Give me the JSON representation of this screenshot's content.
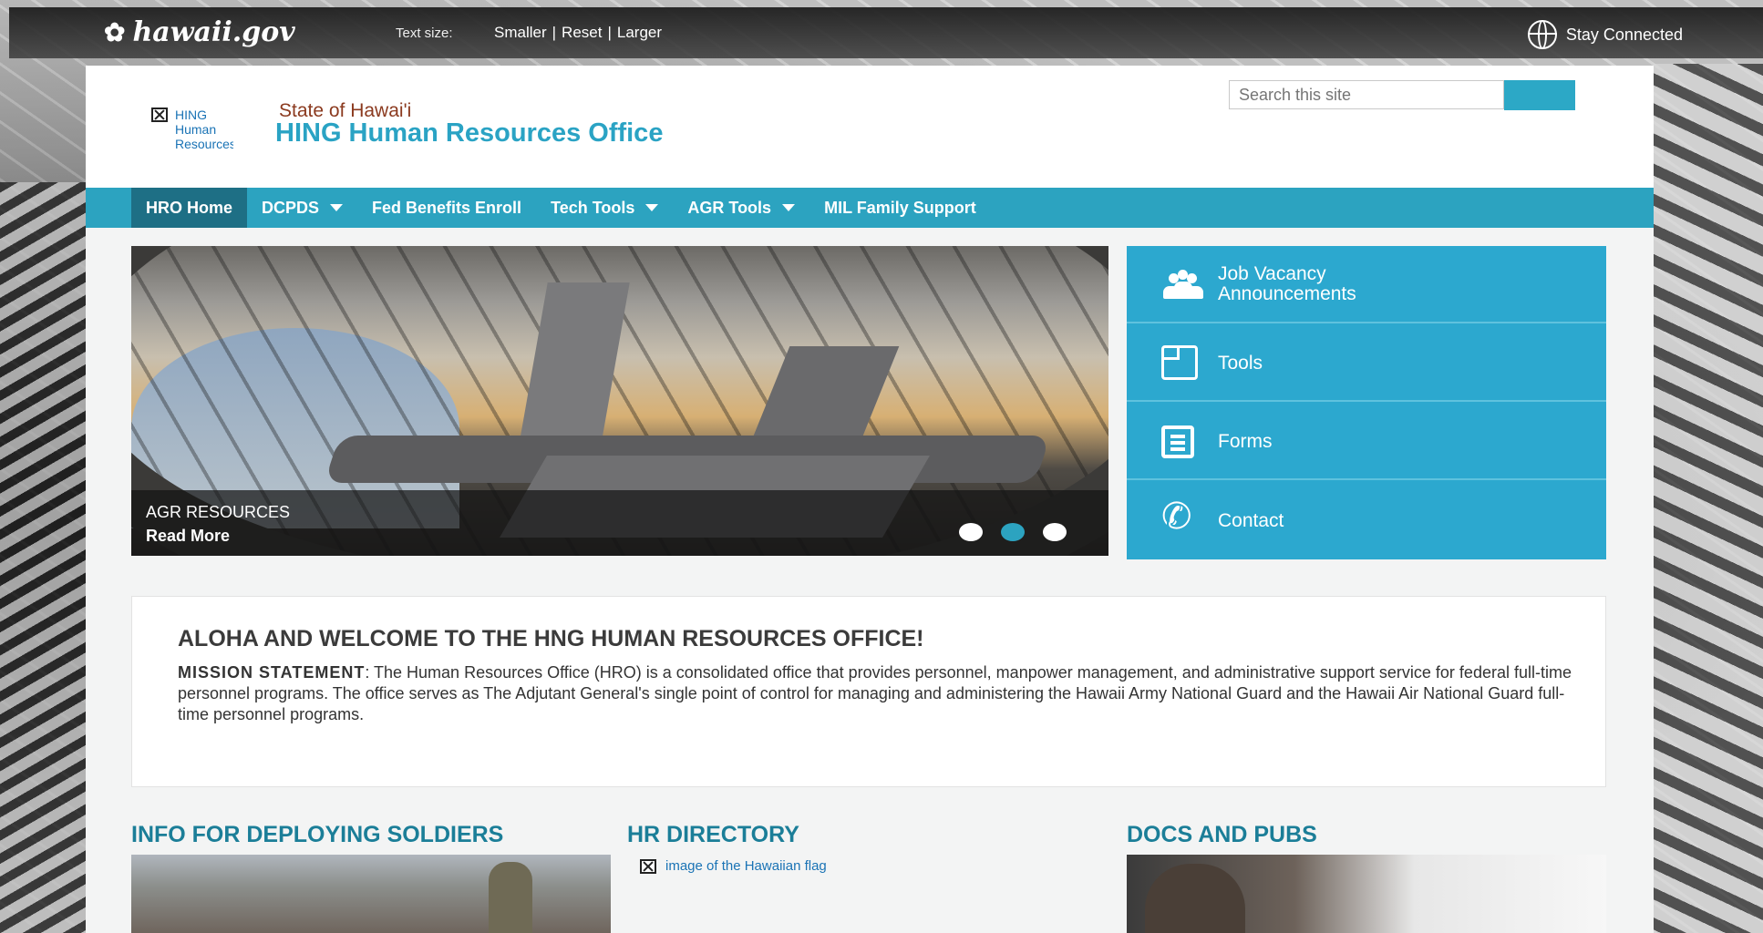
{
  "topbar": {
    "brand": "hawaii.gov",
    "brand_icon": "hibiscus-icon",
    "text_size_label": "Text size:",
    "smaller": "Smaller",
    "reset": "Reset",
    "larger": "Larger",
    "separator": "|",
    "stay_connected": "Stay Connected"
  },
  "header": {
    "logo_alt": "HING Human Resources",
    "state": "State of Hawai'i",
    "office": "HING Human Resources Office",
    "search_placeholder": "Search this site"
  },
  "nav": {
    "items": [
      {
        "label": "HRO Home",
        "active": true,
        "dropdown": false
      },
      {
        "label": "DCPDS",
        "active": false,
        "dropdown": true
      },
      {
        "label": "Fed Benefits Enroll",
        "active": false,
        "dropdown": false
      },
      {
        "label": "Tech Tools",
        "active": false,
        "dropdown": true
      },
      {
        "label": "AGR Tools",
        "active": false,
        "dropdown": true
      },
      {
        "label": "MIL Family Support",
        "active": false,
        "dropdown": false
      }
    ]
  },
  "carousel": {
    "caption_title": "AGR RESOURCES",
    "read_more": "Read More",
    "slide_count": 3,
    "active_slide": 2
  },
  "quick_links": [
    {
      "label_line1": "Job Vacancy",
      "label_line2": "Announcements",
      "icon": "users-icon"
    },
    {
      "label_line1": "Tools",
      "label_line2": "",
      "icon": "document-icon"
    },
    {
      "label_line1": "Forms",
      "label_line2": "",
      "icon": "form-list-icon"
    },
    {
      "label_line1": "Contact",
      "label_line2": "",
      "icon": "phone-icon"
    }
  ],
  "welcome": {
    "title": "ALOHA AND WELCOME TO THE HNG HUMAN RESOURCES OFFICE!",
    "mission_label": "MISSION STATEMENT",
    "mission_text": ": The Human Resources Office (HRO) is a consolidated office that provides personnel, manpower management, and administrative support service for federal full-time personnel programs. The office serves as The Adjutant General's single point of control for managing and administering the Hawaii Army National Guard and the Hawaii Air National Guard full-time personnel programs."
  },
  "sections": {
    "deploying": "INFO FOR DEPLOYING SOLDIERS",
    "hr_directory": "HR DIRECTORY",
    "hr_flag_alt": "image of the Hawaiian flag",
    "docs": "DOCS AND PUBS"
  },
  "colors": {
    "accent": "#2ca3c0",
    "nav_active": "#1e6f85",
    "quick_links_bg": "#2ca8cf",
    "section_title": "#1b7e98",
    "state_text": "#8b3a1f"
  }
}
